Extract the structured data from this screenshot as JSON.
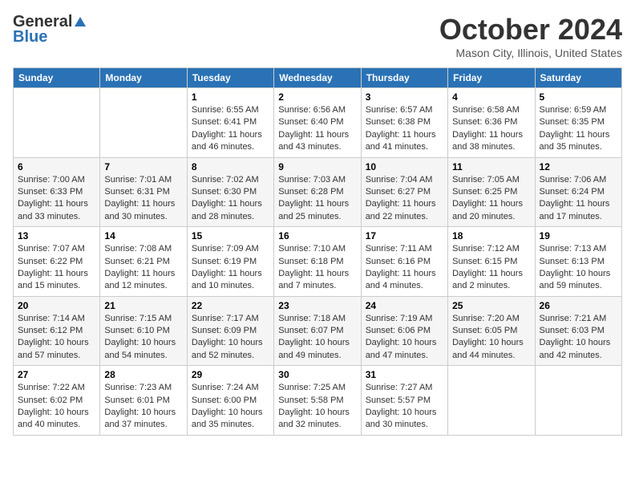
{
  "header": {
    "logo_general": "General",
    "logo_blue": "Blue",
    "month": "October 2024",
    "location": "Mason City, Illinois, United States"
  },
  "days_of_week": [
    "Sunday",
    "Monday",
    "Tuesday",
    "Wednesday",
    "Thursday",
    "Friday",
    "Saturday"
  ],
  "weeks": [
    [
      {
        "day": "",
        "info": ""
      },
      {
        "day": "",
        "info": ""
      },
      {
        "day": "1",
        "info": "Sunrise: 6:55 AM\nSunset: 6:41 PM\nDaylight: 11 hours and 46 minutes."
      },
      {
        "day": "2",
        "info": "Sunrise: 6:56 AM\nSunset: 6:40 PM\nDaylight: 11 hours and 43 minutes."
      },
      {
        "day": "3",
        "info": "Sunrise: 6:57 AM\nSunset: 6:38 PM\nDaylight: 11 hours and 41 minutes."
      },
      {
        "day": "4",
        "info": "Sunrise: 6:58 AM\nSunset: 6:36 PM\nDaylight: 11 hours and 38 minutes."
      },
      {
        "day": "5",
        "info": "Sunrise: 6:59 AM\nSunset: 6:35 PM\nDaylight: 11 hours and 35 minutes."
      }
    ],
    [
      {
        "day": "6",
        "info": "Sunrise: 7:00 AM\nSunset: 6:33 PM\nDaylight: 11 hours and 33 minutes."
      },
      {
        "day": "7",
        "info": "Sunrise: 7:01 AM\nSunset: 6:31 PM\nDaylight: 11 hours and 30 minutes."
      },
      {
        "day": "8",
        "info": "Sunrise: 7:02 AM\nSunset: 6:30 PM\nDaylight: 11 hours and 28 minutes."
      },
      {
        "day": "9",
        "info": "Sunrise: 7:03 AM\nSunset: 6:28 PM\nDaylight: 11 hours and 25 minutes."
      },
      {
        "day": "10",
        "info": "Sunrise: 7:04 AM\nSunset: 6:27 PM\nDaylight: 11 hours and 22 minutes."
      },
      {
        "day": "11",
        "info": "Sunrise: 7:05 AM\nSunset: 6:25 PM\nDaylight: 11 hours and 20 minutes."
      },
      {
        "day": "12",
        "info": "Sunrise: 7:06 AM\nSunset: 6:24 PM\nDaylight: 11 hours and 17 minutes."
      }
    ],
    [
      {
        "day": "13",
        "info": "Sunrise: 7:07 AM\nSunset: 6:22 PM\nDaylight: 11 hours and 15 minutes."
      },
      {
        "day": "14",
        "info": "Sunrise: 7:08 AM\nSunset: 6:21 PM\nDaylight: 11 hours and 12 minutes."
      },
      {
        "day": "15",
        "info": "Sunrise: 7:09 AM\nSunset: 6:19 PM\nDaylight: 11 hours and 10 minutes."
      },
      {
        "day": "16",
        "info": "Sunrise: 7:10 AM\nSunset: 6:18 PM\nDaylight: 11 hours and 7 minutes."
      },
      {
        "day": "17",
        "info": "Sunrise: 7:11 AM\nSunset: 6:16 PM\nDaylight: 11 hours and 4 minutes."
      },
      {
        "day": "18",
        "info": "Sunrise: 7:12 AM\nSunset: 6:15 PM\nDaylight: 11 hours and 2 minutes."
      },
      {
        "day": "19",
        "info": "Sunrise: 7:13 AM\nSunset: 6:13 PM\nDaylight: 10 hours and 59 minutes."
      }
    ],
    [
      {
        "day": "20",
        "info": "Sunrise: 7:14 AM\nSunset: 6:12 PM\nDaylight: 10 hours and 57 minutes."
      },
      {
        "day": "21",
        "info": "Sunrise: 7:15 AM\nSunset: 6:10 PM\nDaylight: 10 hours and 54 minutes."
      },
      {
        "day": "22",
        "info": "Sunrise: 7:17 AM\nSunset: 6:09 PM\nDaylight: 10 hours and 52 minutes."
      },
      {
        "day": "23",
        "info": "Sunrise: 7:18 AM\nSunset: 6:07 PM\nDaylight: 10 hours and 49 minutes."
      },
      {
        "day": "24",
        "info": "Sunrise: 7:19 AM\nSunset: 6:06 PM\nDaylight: 10 hours and 47 minutes."
      },
      {
        "day": "25",
        "info": "Sunrise: 7:20 AM\nSunset: 6:05 PM\nDaylight: 10 hours and 44 minutes."
      },
      {
        "day": "26",
        "info": "Sunrise: 7:21 AM\nSunset: 6:03 PM\nDaylight: 10 hours and 42 minutes."
      }
    ],
    [
      {
        "day": "27",
        "info": "Sunrise: 7:22 AM\nSunset: 6:02 PM\nDaylight: 10 hours and 40 minutes."
      },
      {
        "day": "28",
        "info": "Sunrise: 7:23 AM\nSunset: 6:01 PM\nDaylight: 10 hours and 37 minutes."
      },
      {
        "day": "29",
        "info": "Sunrise: 7:24 AM\nSunset: 6:00 PM\nDaylight: 10 hours and 35 minutes."
      },
      {
        "day": "30",
        "info": "Sunrise: 7:25 AM\nSunset: 5:58 PM\nDaylight: 10 hours and 32 minutes."
      },
      {
        "day": "31",
        "info": "Sunrise: 7:27 AM\nSunset: 5:57 PM\nDaylight: 10 hours and 30 minutes."
      },
      {
        "day": "",
        "info": ""
      },
      {
        "day": "",
        "info": ""
      }
    ]
  ]
}
